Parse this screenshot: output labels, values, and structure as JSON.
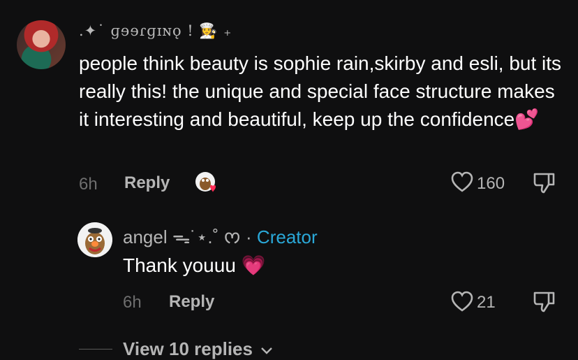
{
  "comment": {
    "username": ".✦˙ ɡɘɘɾɡɪɴǫ ! 👩‍🍳 ₊",
    "text": "people think beauty is sophie rain,skirby and esli, but its really this! the unique and special face structure makes it interesting and beautiful, keep up the confidence💕",
    "time": "6h",
    "reply_label": "Reply",
    "like_count": "160",
    "icons": [
      "avatar",
      "creator-liked-avatar",
      "heart-outline-icon",
      "dislike-icon"
    ]
  },
  "reply": {
    "username": "angel ᯓ˙⋆.˚ ᰔ",
    "separator": "·",
    "creator_badge": "Creator",
    "text": "Thank youuu 💗",
    "time": "6h",
    "reply_label": "Reply",
    "like_count": "21"
  },
  "thread": {
    "view_replies_label": "View 10 replies",
    "chevron_icon": "chevron-down-icon"
  },
  "colors": {
    "background": "#0f0f10",
    "text": "#ffffff",
    "muted": "#b5b5b5",
    "time": "#6e6e6e",
    "creator": "#2aa8d8",
    "heart_emoji": "#ff4fa8"
  }
}
